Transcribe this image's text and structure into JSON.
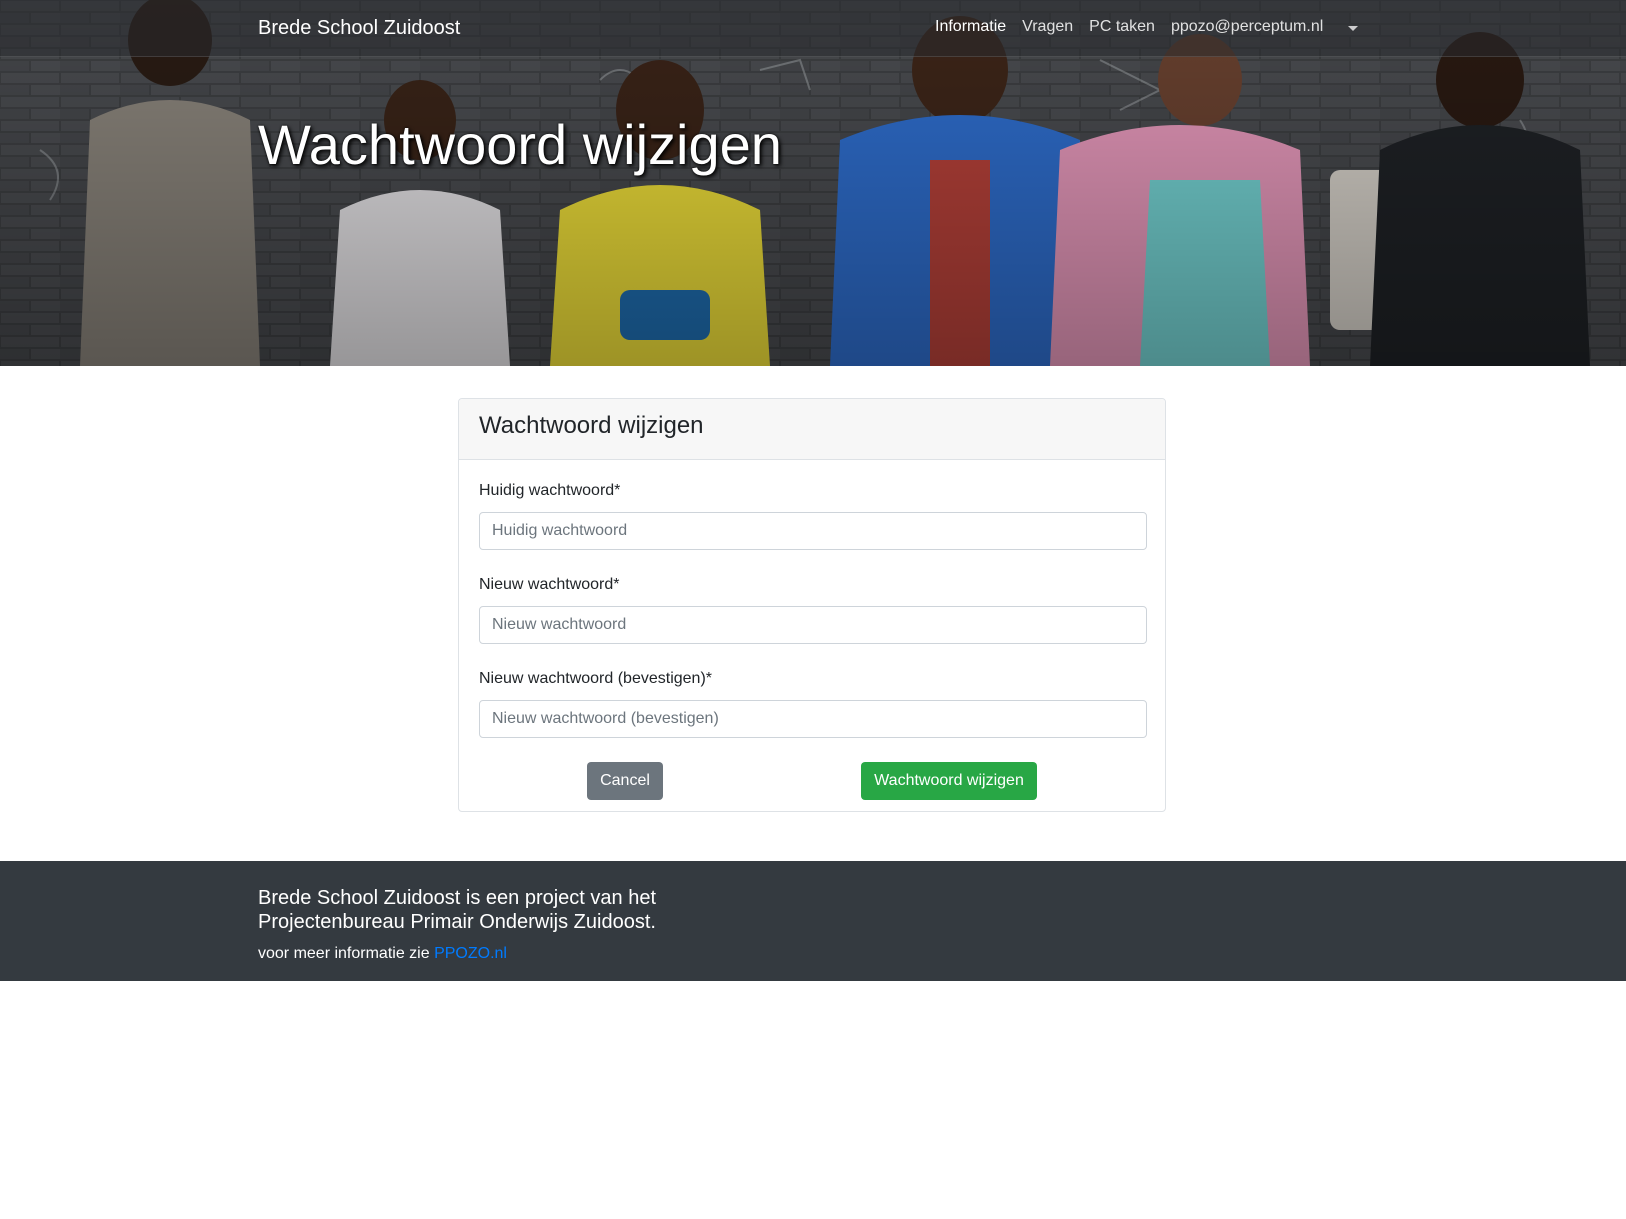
{
  "navbar": {
    "brand": "Brede School Zuidoost",
    "items": [
      {
        "label": "Informatie"
      },
      {
        "label": "Vragen"
      },
      {
        "label": "PC taken"
      },
      {
        "label": "ppozo@perceptum.nl"
      }
    ]
  },
  "hero": {
    "title": "Wachtwoord wijzigen"
  },
  "form": {
    "title": "Wachtwoord wijzigen",
    "fields": [
      {
        "label": "Huidig wachtwoord*",
        "placeholder": "Huidig wachtwoord",
        "value": ""
      },
      {
        "label": "Nieuw wachtwoord*",
        "placeholder": "Nieuw wachtwoord",
        "value": ""
      },
      {
        "label": "Nieuw wachtwoord (bevestigen)*",
        "placeholder": "Nieuw wachtwoord (bevestigen)",
        "value": ""
      }
    ],
    "cancel_label": "Cancel",
    "submit_label": "Wachtwoord wijzigen"
  },
  "footer": {
    "line1": "Brede School Zuidoost is een project van het",
    "line2": "Projectenbureau Primair Onderwijs Zuidoost.",
    "info_text": "voor meer informatie zie ",
    "link_label": "PPOZO.nl"
  },
  "colors": {
    "navbar_bg": "#2b2d31",
    "footer_bg": "#343a40",
    "primary_link": "#007bff",
    "cancel_button": "#6c757d",
    "submit_button": "#28a745",
    "card_header_bg": "#f7f7f7"
  },
  "icons": {
    "account_dropdown": "chevron-down-icon"
  }
}
